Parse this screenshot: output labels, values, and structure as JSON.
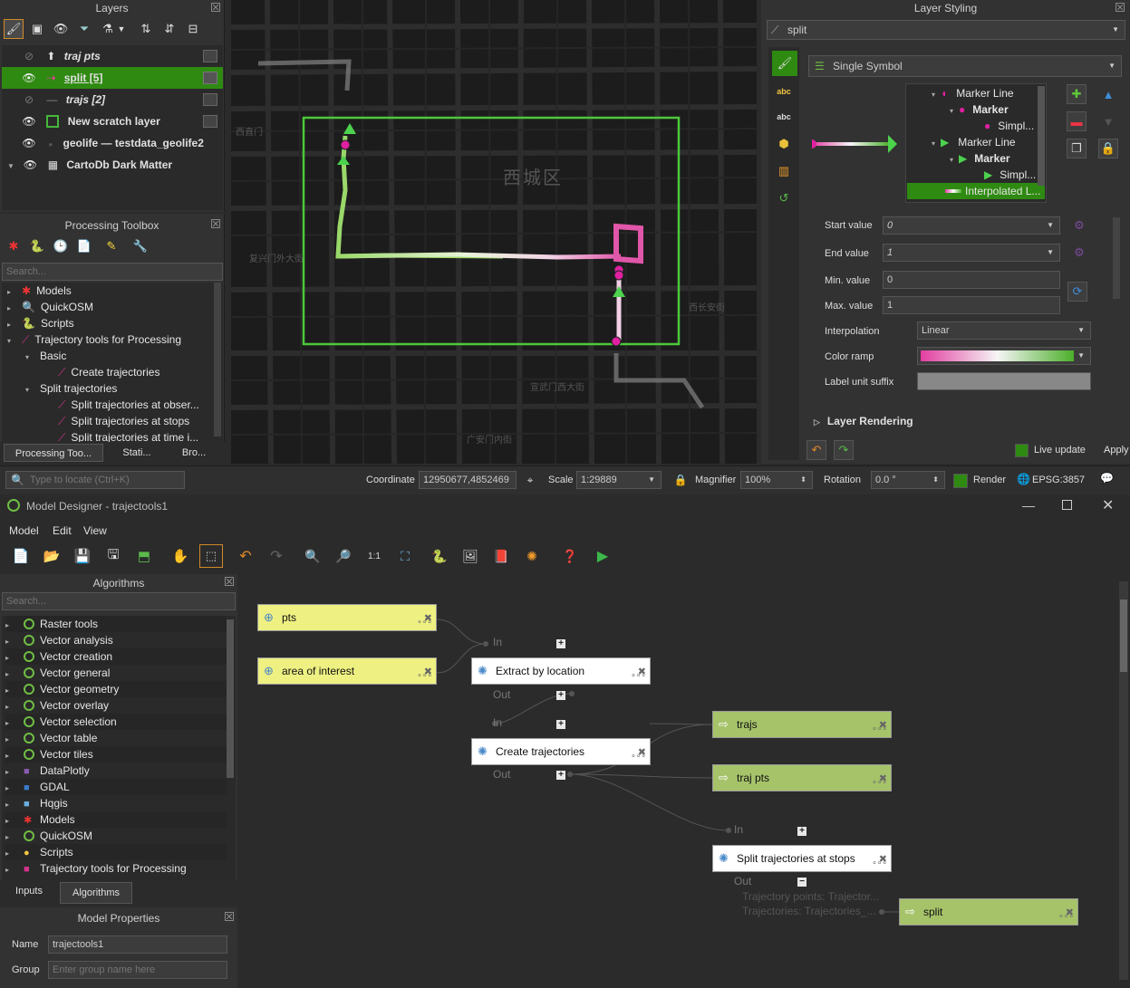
{
  "layers_panel": {
    "title": "Layers",
    "layers": [
      {
        "name": "traj pts",
        "visible": false,
        "italic": true
      },
      {
        "name": "split [5]",
        "visible": true,
        "italic": false,
        "selected": true
      },
      {
        "name": "trajs [2]",
        "visible": false,
        "italic": true
      },
      {
        "name": "New scratch layer",
        "visible": true
      },
      {
        "name": "geolife — testdata_geolife2",
        "visible": true
      },
      {
        "name": "CartoDb Dark Matter",
        "visible": true
      }
    ]
  },
  "toolbox": {
    "title": "Processing Toolbox",
    "search_placeholder": "Search...",
    "items": [
      {
        "label": "Models"
      },
      {
        "label": "QuickOSM"
      },
      {
        "label": "Scripts"
      },
      {
        "label": "Trajectory tools for Processing"
      },
      {
        "label": "Basic"
      },
      {
        "label": "Create trajectories"
      },
      {
        "label": "Split trajectories"
      },
      {
        "label": "Split trajectories at obser..."
      },
      {
        "label": "Split trajectories at stops"
      },
      {
        "label": "Split trajectories at time i..."
      }
    ],
    "tabs": [
      "Processing Too...",
      "Stati...",
      "Bro..."
    ]
  },
  "map": {
    "district_label": "西城区",
    "street_labels": [
      "复兴门外大街",
      "西长安街",
      "宣武门西大街",
      "广安门内街",
      "西直门"
    ]
  },
  "styling": {
    "title": "Layer Styling",
    "layer": "split",
    "renderer": "Single Symbol",
    "symbol_tree": [
      "Marker Line",
      "Marker",
      "Simpl...",
      "Marker Line",
      "Marker",
      "Simpl...",
      "Interpolated L..."
    ],
    "start_value_label": "Start value",
    "start_value": "0",
    "end_value_label": "End value",
    "end_value": "1",
    "min_label": "Min. value",
    "min_value": "0",
    "max_label": "Max. value",
    "max_value": "1",
    "interp_label": "Interpolation",
    "interp_value": "Linear",
    "ramp_label": "Color ramp",
    "suffix_label": "Label unit suffix",
    "rendering_label": "Layer Rendering",
    "live_update": "Live update",
    "apply": "Apply",
    "ramp_start": "#e13ea0",
    "ramp_end": "#4caf2a"
  },
  "statusbar": {
    "locate_placeholder": "Type to locate (Ctrl+K)",
    "coordinate_label": "Coordinate",
    "coordinate_value": "12950677,4852469",
    "scale_label": "Scale",
    "scale_value": "1:29889",
    "magnifier_label": "Magnifier",
    "magnifier_value": "100%",
    "rotation_label": "Rotation",
    "rotation_value": "0.0 °",
    "render_label": "Render",
    "crs": "EPSG:3857"
  },
  "designer": {
    "window_title": "Model Designer - trajectools1",
    "menus": [
      "Model",
      "Edit",
      "View"
    ],
    "algorithms_title": "Algorithms",
    "search_placeholder": "Search...",
    "algorithms": [
      "Raster tools",
      "Vector analysis",
      "Vector creation",
      "Vector general",
      "Vector geometry",
      "Vector overlay",
      "Vector selection",
      "Vector table",
      "Vector tiles",
      "DataPlotly",
      "GDAL",
      "Hqgis",
      "Models",
      "QuickOSM",
      "Scripts",
      "Trajectory tools for Processing"
    ],
    "left_tabs": [
      "Inputs",
      "Algorithms"
    ],
    "props_title": "Model Properties",
    "name_label": "Name",
    "name_value": "trajectools1",
    "group_label": "Group",
    "group_placeholder": "Enter group name here",
    "nodes": {
      "pts": "pts",
      "aoi": "area of interest",
      "extract": "Extract by location",
      "create": "Create trajectories",
      "trajs": "trajs",
      "trajpts": "traj pts",
      "splitstops": "Split trajectories at stops",
      "split": "split"
    },
    "port_in": "In",
    "port_out": "Out",
    "out_detail_1": "Trajectory points: Trajector...",
    "out_detail_2": "Trajectories: Trajectories_..."
  }
}
